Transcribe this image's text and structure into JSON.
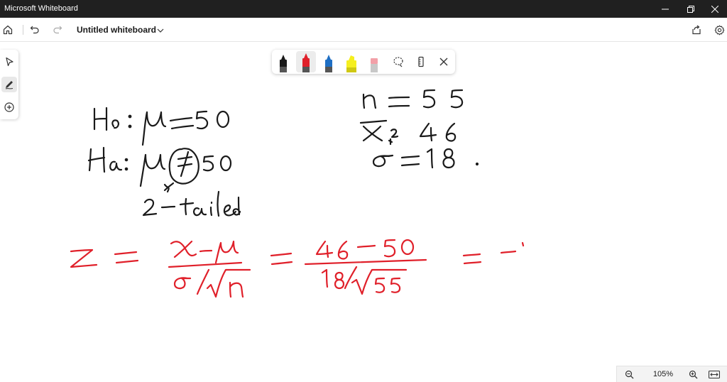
{
  "window": {
    "title": "Microsoft Whiteboard"
  },
  "header": {
    "board_title": "Untitled whiteboard"
  },
  "zoom": {
    "level": "105%"
  },
  "left_rail": {
    "items": [
      "select",
      "pen",
      "add"
    ],
    "active": "pen"
  },
  "pen_toolbar": {
    "pens": [
      {
        "name": "black-pen",
        "color": "#1a1a1a"
      },
      {
        "name": "red-pen",
        "color": "#e0202a",
        "active": true
      },
      {
        "name": "blue-pen",
        "color": "#1f6fc4"
      },
      {
        "name": "yellow-highlighter",
        "color": "#f5ef1f"
      },
      {
        "name": "eraser",
        "color": "#f2a0a8"
      }
    ]
  },
  "colors": {
    "ink_black": "#1a1a1a",
    "ink_red": "#e0202a",
    "titlebar_bg": "#202020"
  }
}
